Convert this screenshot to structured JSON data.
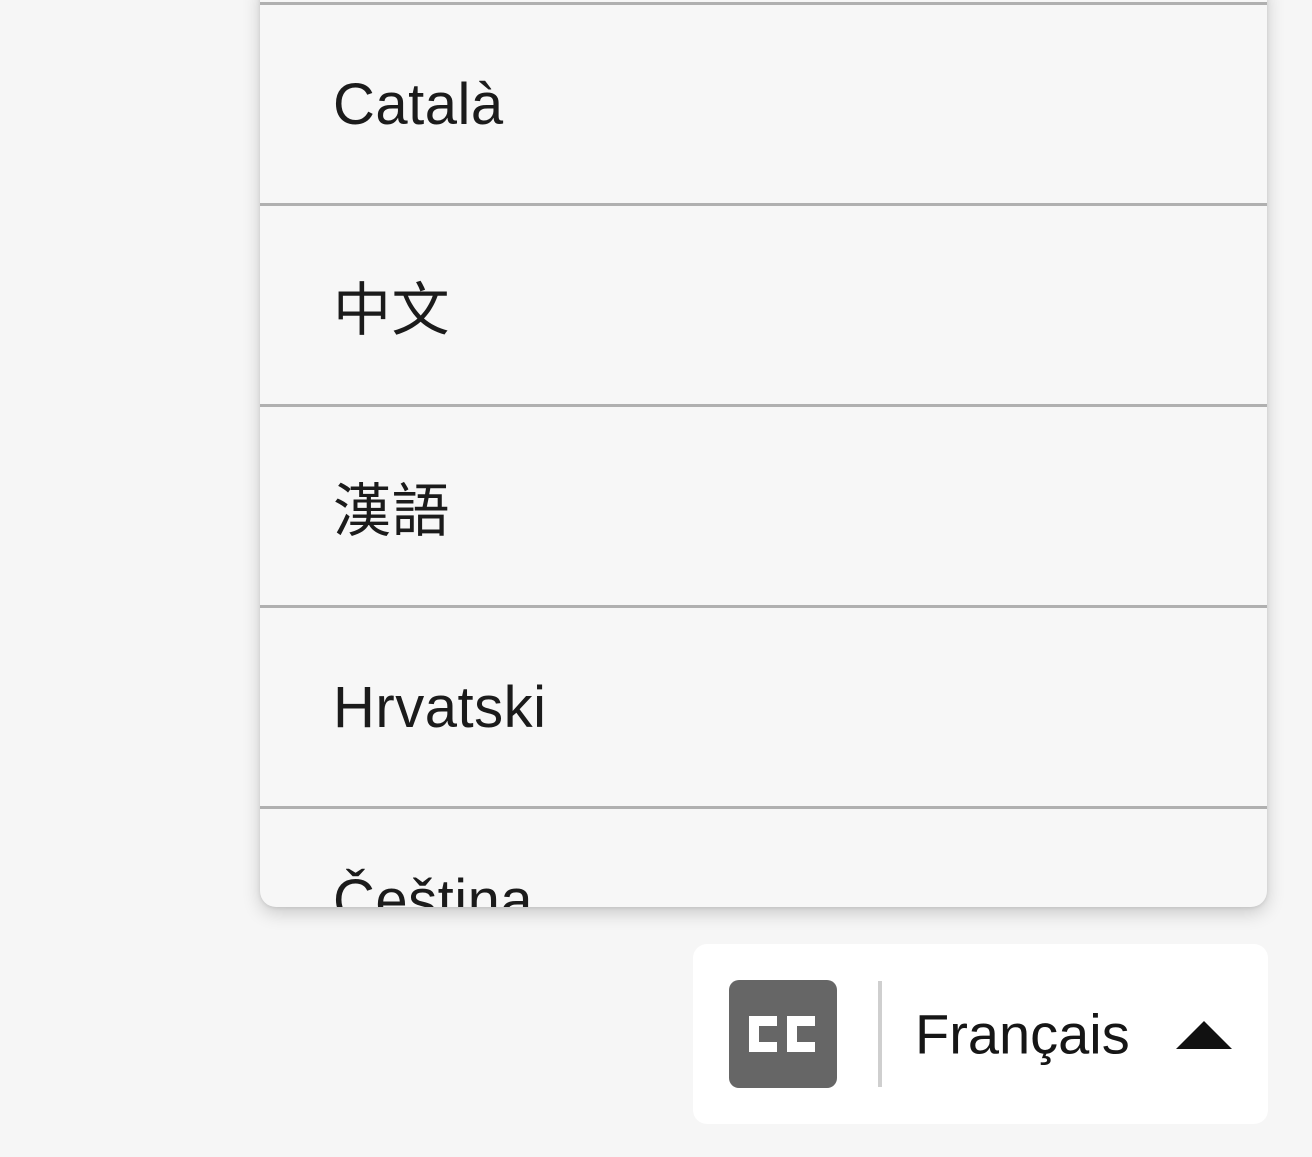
{
  "language_menu": {
    "items": [
      {
        "label": ""
      },
      {
        "label": "Català"
      },
      {
        "label": "中文"
      },
      {
        "label": "漢語"
      },
      {
        "label": "Hrvatski"
      },
      {
        "label": "Čeština"
      }
    ]
  },
  "caption_control": {
    "icon": "closed-captions-icon",
    "icon_text": "CC",
    "selected_language": "Français",
    "toggle_icon": "caret-up-icon"
  },
  "colors": {
    "background": "#f6f6f6",
    "cc_badge": "#666666",
    "divider": "#b0b0b0"
  }
}
